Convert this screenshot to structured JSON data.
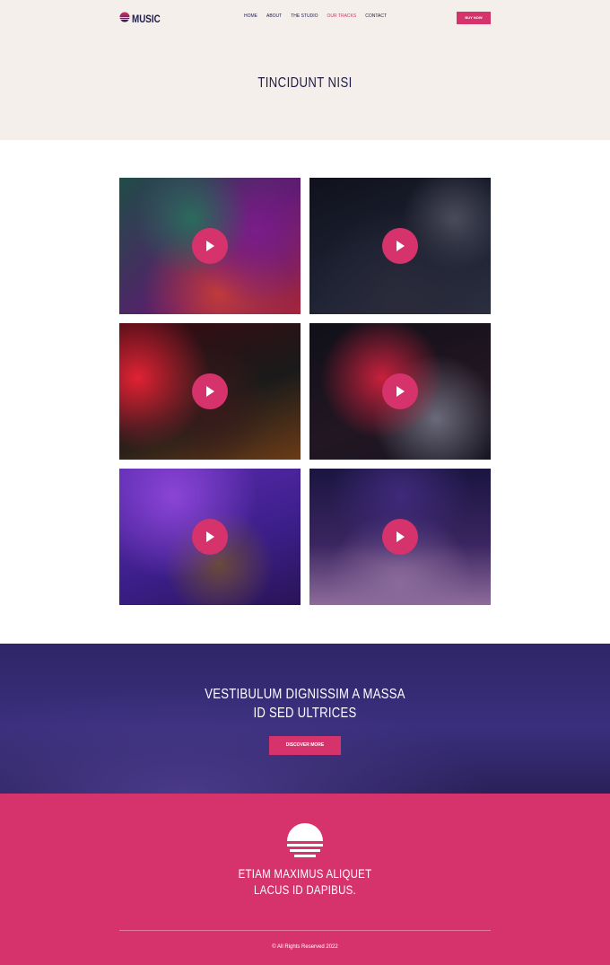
{
  "header": {
    "logo_text": "MUSIC",
    "nav": [
      {
        "label": "HOME",
        "active": false
      },
      {
        "label": "ABOUT",
        "active": false
      },
      {
        "label": "THE STUDIO",
        "active": false
      },
      {
        "label": "OUR TRACKS",
        "active": true
      },
      {
        "label": "CONTACT",
        "active": false
      }
    ],
    "buy_label": "BUY NOW"
  },
  "hero": {
    "title": "TINCIDUNT NISI"
  },
  "tracks": [
    {
      "name": "track-1",
      "icon": "play-icon"
    },
    {
      "name": "track-2",
      "icon": "play-icon"
    },
    {
      "name": "track-3",
      "icon": "play-icon"
    },
    {
      "name": "track-4",
      "icon": "play-icon"
    },
    {
      "name": "track-5",
      "icon": "play-icon"
    },
    {
      "name": "track-6",
      "icon": "play-icon"
    }
  ],
  "cta": {
    "title_line1": "VESTIBULUM DIGNISSIM A MASSA",
    "title_line2": "ID SED ULTRICES",
    "button_label": "DISCOVER MORE"
  },
  "footer": {
    "title_line1": "ETIAM MAXIMUS ALIQUET",
    "title_line2": "LACUS ID DAPIBUS.",
    "copyright": "© All Rights Reserved 2022"
  },
  "colors": {
    "accent": "#d6336c",
    "navy": "#1e1b4b",
    "hero_bg": "#f4efea",
    "cta_bg": "#2e2668"
  }
}
